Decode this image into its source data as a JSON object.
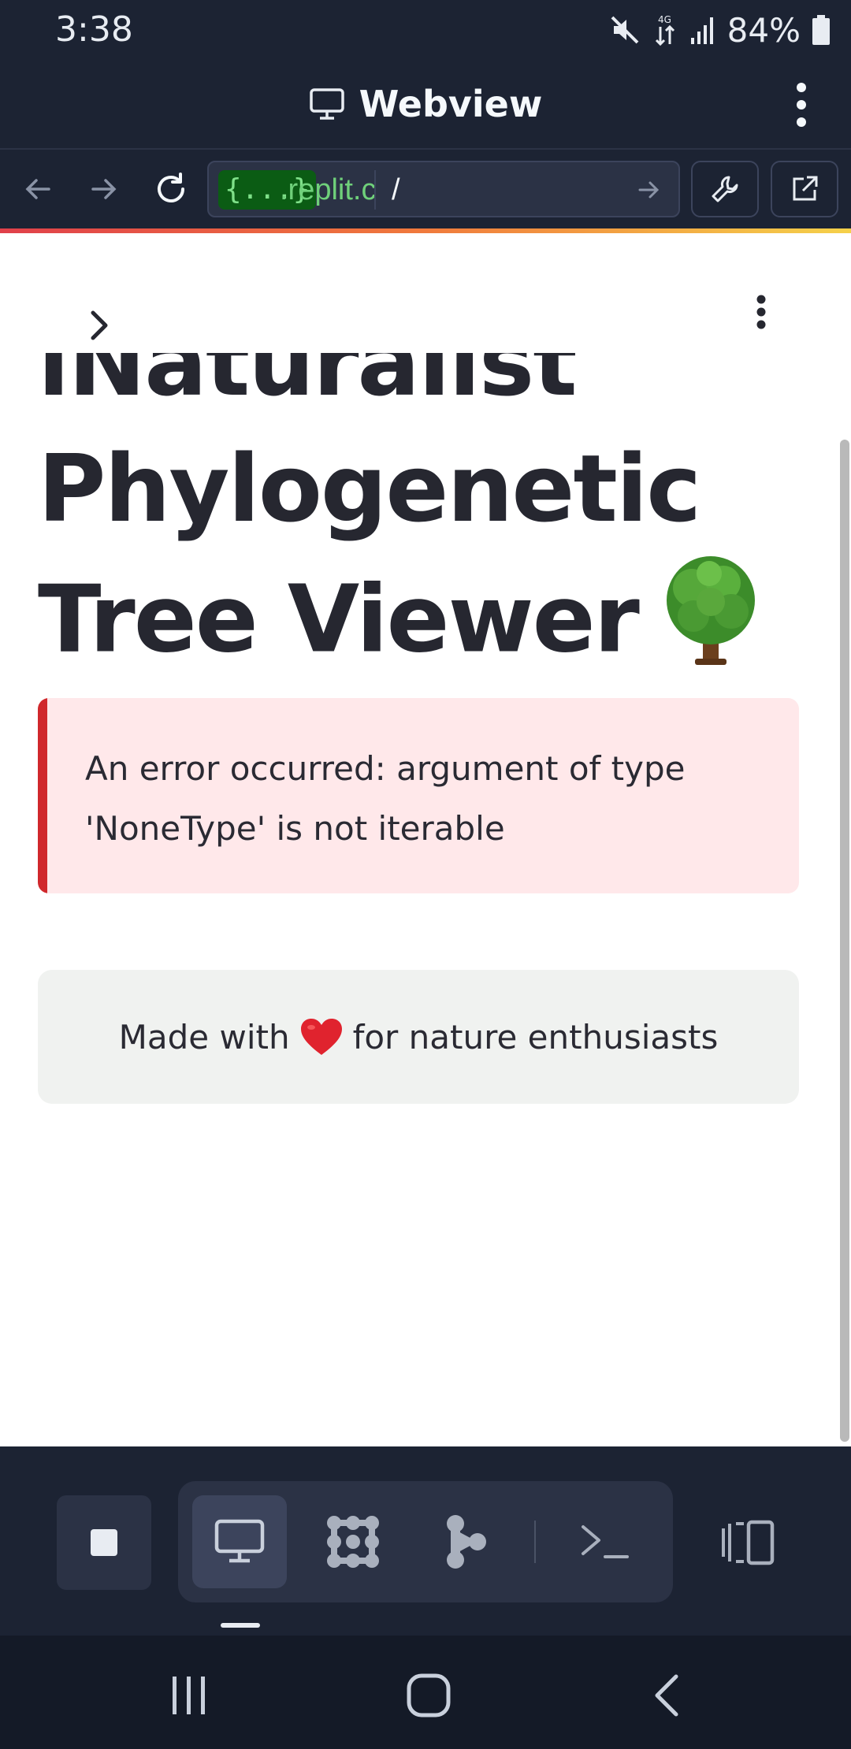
{
  "status_bar": {
    "time": "3:38",
    "battery": "84%"
  },
  "header": {
    "title": "Webview"
  },
  "url_bar": {
    "chip": "{...}",
    "domain": ".replit.c",
    "path": "/"
  },
  "app": {
    "title_partial_line": "iNaturalist",
    "title_line_1": "Phylogenetic",
    "title_line_2": "Tree Viewer",
    "title_emoji": "tree",
    "error_line_1": "An error occurred: argument of type",
    "error_line_2": "'NoneType' is not iterable",
    "footer_before": "Made with",
    "footer_after": "for nature enthusiasts"
  },
  "colors": {
    "chrome_bg": "#1c2333",
    "error_bg": "#ffe8ea",
    "error_accent": "#d0282c",
    "footer_bg": "#f0f2f0"
  }
}
